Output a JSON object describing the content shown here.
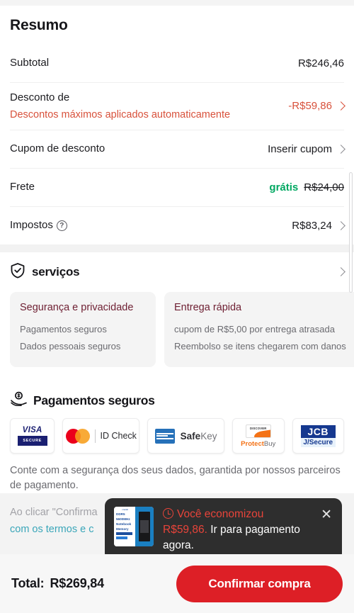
{
  "summary": {
    "title": "Resumo",
    "rows": [
      {
        "label": "Subtotal",
        "value": "R$246,46"
      },
      {
        "label": "Desconto de",
        "sublabel": "Descontos máximos aplicados automaticamente",
        "value": "-R$59,86"
      },
      {
        "label": "Cupom de desconto",
        "value": "Inserir cupom"
      },
      {
        "label": "Frete",
        "value_free": "grátis",
        "value_struck": "R$24,00"
      },
      {
        "label": "Impostos",
        "value": "R$83,24"
      }
    ]
  },
  "services": {
    "title": "serviços",
    "icon": "shield-check-icon",
    "cards": [
      {
        "title": "Segurança e privacidade",
        "lines": [
          "Pagamentos seguros",
          "Dados pessoais seguros"
        ]
      },
      {
        "title": "Entrega rápida",
        "lines": [
          "cupom de R$5,00 por entrega atrasada",
          "Reembolso se itens chegarem com danos"
        ]
      }
    ]
  },
  "payments": {
    "title": "Pagamentos seguros",
    "icon": "hand-coin-icon",
    "badges": [
      {
        "name": "visa-secure",
        "word": "VISA",
        "tag": "SECURE"
      },
      {
        "name": "mastercard-id-check",
        "text": "ID Check"
      },
      {
        "name": "amex-safekey",
        "text_bold": "Safe",
        "text_light": "Key"
      },
      {
        "name": "discover-protectbuy",
        "card_text": "DISCOVER",
        "text_bold": "Protect",
        "text_light": "Buy"
      },
      {
        "name": "jcb-j-secure",
        "top": "JCB",
        "bottom": "J/Secure"
      }
    ],
    "note": "Conte com a segurança dos seus dados, garantida por nossos parceiros de pagamento."
  },
  "terms": {
    "line1_prefix": "Ao clicar \"Confirma",
    "line2_link": "com os termos e c"
  },
  "toast": {
    "icon": "clock-icon",
    "highlight_1": "Você economizou",
    "highlight_2": "R$59,86.",
    "rest": "Ir para pagamento agora.",
    "close_icon": "close-icon",
    "product_thumb": {
      "brand": "crucial",
      "line1": "DDR5",
      "line2": "5600MHz",
      "line3": "Notebook",
      "line4": "Memory"
    }
  },
  "footer": {
    "total_label": "Total:",
    "total_value": "R$269,84",
    "confirm_label": "Confirmar compra"
  },
  "colors": {
    "accent_red": "#dd1f26",
    "discount_red": "#d8513b",
    "free_green": "#00a862",
    "link_teal": "#3aa6b9",
    "card_title_maroon": "#6e1f32"
  }
}
